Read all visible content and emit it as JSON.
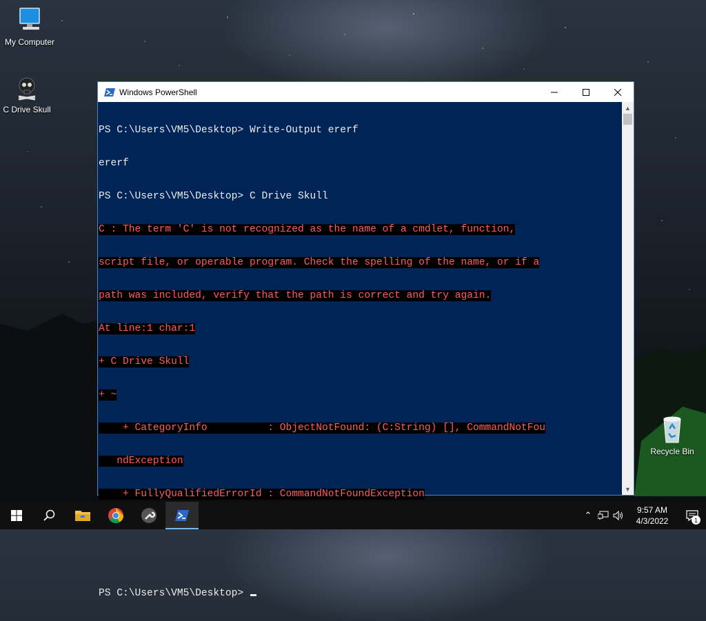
{
  "desktop": {
    "icons": [
      {
        "label": "My Computer",
        "icon": "monitor-icon"
      },
      {
        "label": "C Drive Skull",
        "icon": "skull-icon"
      },
      {
        "label": "Recycle Bin",
        "icon": "recycle-bin-icon"
      }
    ]
  },
  "window": {
    "title": "Windows PowerShell",
    "icon": "powershell-icon",
    "console": {
      "background": "#012456",
      "foreground": "#EEEDF0",
      "error_color": "#FF5C5C",
      "lines": [
        {
          "text": "PS C:\\Users\\VM5\\Desktop> Write-Output ererf",
          "type": "normal"
        },
        {
          "text": "ererf",
          "type": "normal"
        },
        {
          "text": "PS C:\\Users\\VM5\\Desktop> C Drive Skull",
          "type": "normal"
        },
        {
          "text": "C : The term 'C' is not recognized as the name of a cmdlet, function,",
          "type": "error"
        },
        {
          "text": "script file, or operable program. Check the spelling of the name, or if a",
          "type": "error"
        },
        {
          "text": "path was included, verify that the path is correct and try again.",
          "type": "error"
        },
        {
          "text": "At line:1 char:1",
          "type": "error"
        },
        {
          "text": "+ C Drive Skull",
          "type": "error"
        },
        {
          "text": "+ ~",
          "type": "error"
        },
        {
          "text": "    + CategoryInfo          : ObjectNotFound: (C:String) [], CommandNotFou",
          "type": "error"
        },
        {
          "text": "   ndException",
          "type": "error"
        },
        {
          "text": "    + FullyQualifiedErrorId : CommandNotFoundException",
          "type": "error"
        },
        {
          "text": "",
          "type": "normal"
        },
        {
          "text": "",
          "type": "normal"
        },
        {
          "text": "PS C:\\Users\\VM5\\Desktop> ",
          "type": "prompt"
        }
      ]
    }
  },
  "taskbar": {
    "items": [
      {
        "name": "start-button",
        "icon": "windows-logo-icon"
      },
      {
        "name": "search-button",
        "icon": "search-icon"
      },
      {
        "name": "file-explorer-button",
        "icon": "folder-icon"
      },
      {
        "name": "chrome-button",
        "icon": "chrome-icon"
      },
      {
        "name": "tool-button",
        "icon": "wrench-icon"
      },
      {
        "name": "powershell-button",
        "icon": "powershell-icon",
        "active": true
      }
    ],
    "tray": {
      "time": "9:57 AM",
      "date": "4/3/2022",
      "notification_count": "1"
    }
  }
}
